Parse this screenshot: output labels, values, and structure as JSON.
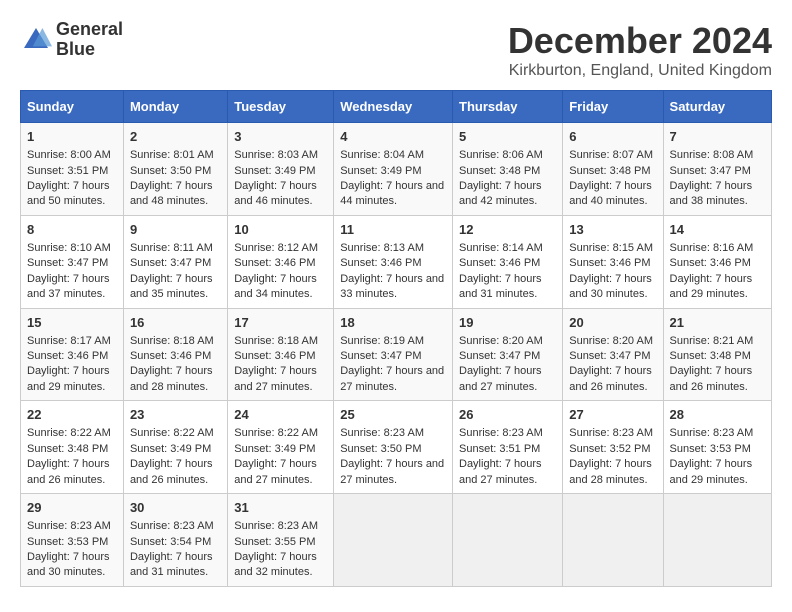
{
  "logo": {
    "line1": "General",
    "line2": "Blue"
  },
  "title": "December 2024",
  "subtitle": "Kirkburton, England, United Kingdom",
  "days_of_week": [
    "Sunday",
    "Monday",
    "Tuesday",
    "Wednesday",
    "Thursday",
    "Friday",
    "Saturday"
  ],
  "weeks": [
    [
      {
        "day": 1,
        "sunrise": "8:00 AM",
        "sunset": "3:51 PM",
        "daylight": "7 hours and 50 minutes."
      },
      {
        "day": 2,
        "sunrise": "8:01 AM",
        "sunset": "3:50 PM",
        "daylight": "7 hours and 48 minutes."
      },
      {
        "day": 3,
        "sunrise": "8:03 AM",
        "sunset": "3:49 PM",
        "daylight": "7 hours and 46 minutes."
      },
      {
        "day": 4,
        "sunrise": "8:04 AM",
        "sunset": "3:49 PM",
        "daylight": "7 hours and 44 minutes."
      },
      {
        "day": 5,
        "sunrise": "8:06 AM",
        "sunset": "3:48 PM",
        "daylight": "7 hours and 42 minutes."
      },
      {
        "day": 6,
        "sunrise": "8:07 AM",
        "sunset": "3:48 PM",
        "daylight": "7 hours and 40 minutes."
      },
      {
        "day": 7,
        "sunrise": "8:08 AM",
        "sunset": "3:47 PM",
        "daylight": "7 hours and 38 minutes."
      }
    ],
    [
      {
        "day": 8,
        "sunrise": "8:10 AM",
        "sunset": "3:47 PM",
        "daylight": "7 hours and 37 minutes."
      },
      {
        "day": 9,
        "sunrise": "8:11 AM",
        "sunset": "3:47 PM",
        "daylight": "7 hours and 35 minutes."
      },
      {
        "day": 10,
        "sunrise": "8:12 AM",
        "sunset": "3:46 PM",
        "daylight": "7 hours and 34 minutes."
      },
      {
        "day": 11,
        "sunrise": "8:13 AM",
        "sunset": "3:46 PM",
        "daylight": "7 hours and 33 minutes."
      },
      {
        "day": 12,
        "sunrise": "8:14 AM",
        "sunset": "3:46 PM",
        "daylight": "7 hours and 31 minutes."
      },
      {
        "day": 13,
        "sunrise": "8:15 AM",
        "sunset": "3:46 PM",
        "daylight": "7 hours and 30 minutes."
      },
      {
        "day": 14,
        "sunrise": "8:16 AM",
        "sunset": "3:46 PM",
        "daylight": "7 hours and 29 minutes."
      }
    ],
    [
      {
        "day": 15,
        "sunrise": "8:17 AM",
        "sunset": "3:46 PM",
        "daylight": "7 hours and 29 minutes."
      },
      {
        "day": 16,
        "sunrise": "8:18 AM",
        "sunset": "3:46 PM",
        "daylight": "7 hours and 28 minutes."
      },
      {
        "day": 17,
        "sunrise": "8:18 AM",
        "sunset": "3:46 PM",
        "daylight": "7 hours and 27 minutes."
      },
      {
        "day": 18,
        "sunrise": "8:19 AM",
        "sunset": "3:47 PM",
        "daylight": "7 hours and 27 minutes."
      },
      {
        "day": 19,
        "sunrise": "8:20 AM",
        "sunset": "3:47 PM",
        "daylight": "7 hours and 27 minutes."
      },
      {
        "day": 20,
        "sunrise": "8:20 AM",
        "sunset": "3:47 PM",
        "daylight": "7 hours and 26 minutes."
      },
      {
        "day": 21,
        "sunrise": "8:21 AM",
        "sunset": "3:48 PM",
        "daylight": "7 hours and 26 minutes."
      }
    ],
    [
      {
        "day": 22,
        "sunrise": "8:22 AM",
        "sunset": "3:48 PM",
        "daylight": "7 hours and 26 minutes."
      },
      {
        "day": 23,
        "sunrise": "8:22 AM",
        "sunset": "3:49 PM",
        "daylight": "7 hours and 26 minutes."
      },
      {
        "day": 24,
        "sunrise": "8:22 AM",
        "sunset": "3:49 PM",
        "daylight": "7 hours and 27 minutes."
      },
      {
        "day": 25,
        "sunrise": "8:23 AM",
        "sunset": "3:50 PM",
        "daylight": "7 hours and 27 minutes."
      },
      {
        "day": 26,
        "sunrise": "8:23 AM",
        "sunset": "3:51 PM",
        "daylight": "7 hours and 27 minutes."
      },
      {
        "day": 27,
        "sunrise": "8:23 AM",
        "sunset": "3:52 PM",
        "daylight": "7 hours and 28 minutes."
      },
      {
        "day": 28,
        "sunrise": "8:23 AM",
        "sunset": "3:53 PM",
        "daylight": "7 hours and 29 minutes."
      }
    ],
    [
      {
        "day": 29,
        "sunrise": "8:23 AM",
        "sunset": "3:53 PM",
        "daylight": "7 hours and 30 minutes."
      },
      {
        "day": 30,
        "sunrise": "8:23 AM",
        "sunset": "3:54 PM",
        "daylight": "7 hours and 31 minutes."
      },
      {
        "day": 31,
        "sunrise": "8:23 AM",
        "sunset": "3:55 PM",
        "daylight": "7 hours and 32 minutes."
      },
      null,
      null,
      null,
      null
    ]
  ],
  "labels": {
    "sunrise": "Sunrise:",
    "sunset": "Sunset:",
    "daylight": "Daylight:"
  }
}
